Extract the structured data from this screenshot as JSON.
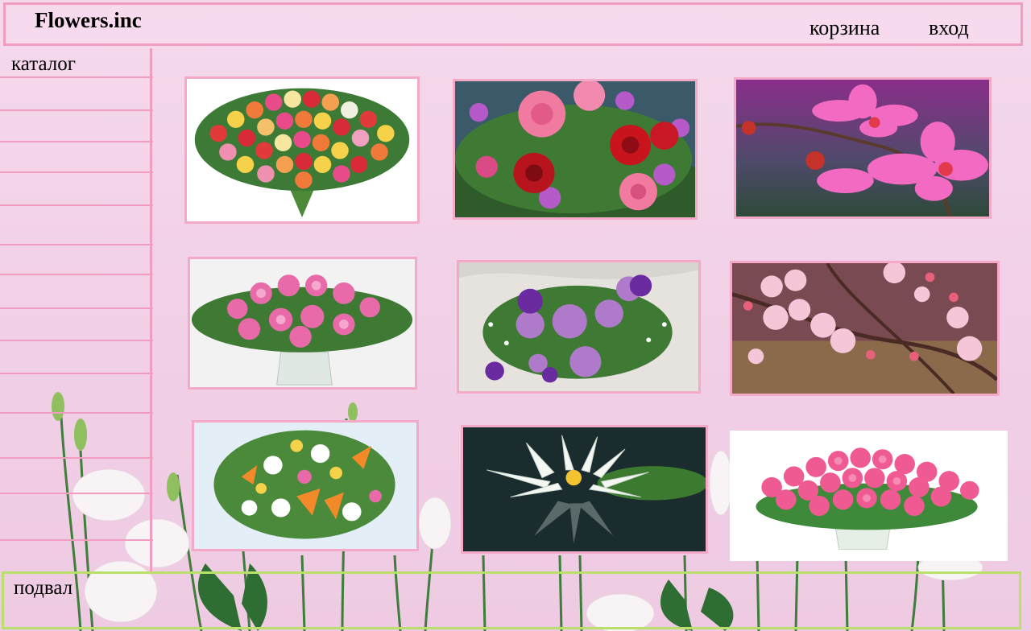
{
  "header": {
    "logo": "Flowers.inc",
    "nav": {
      "cart": "корзина",
      "login": "вход"
    }
  },
  "sidebar": {
    "title": "каталог",
    "item_count": 14
  },
  "catalog": {
    "cards": [
      {
        "name": "mixed-roses-bouquet"
      },
      {
        "name": "pink-red-roses-bouquet"
      },
      {
        "name": "pink-orchid"
      },
      {
        "name": "pink-lilies-vase"
      },
      {
        "name": "purple-roses-bouquet"
      },
      {
        "name": "cherry-blossom-branch"
      },
      {
        "name": "lilies-mixed-bouquet"
      },
      {
        "name": "water-lily"
      },
      {
        "name": "pink-roses-basket"
      }
    ]
  },
  "footer": {
    "label": "подвал"
  },
  "colors": {
    "border_pink": "#f29cc2",
    "footer_border": "#b9e06a",
    "background": "#f3d3e9"
  }
}
